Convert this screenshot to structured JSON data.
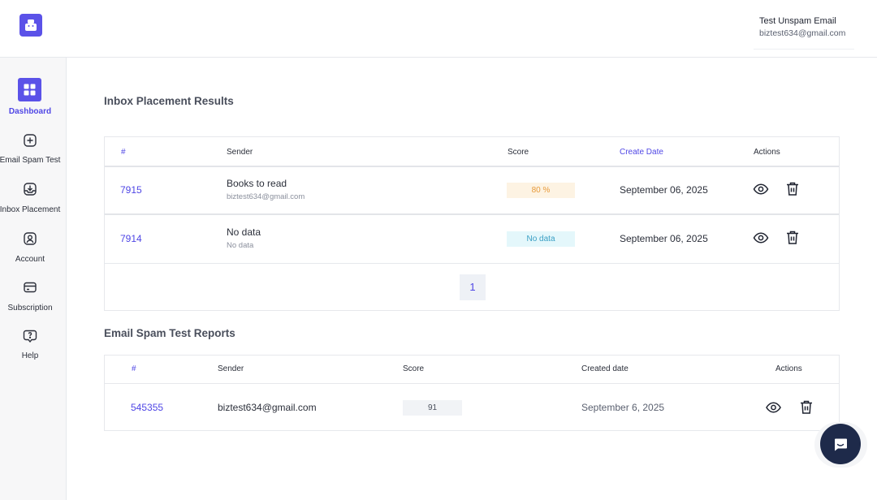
{
  "header": {
    "user_name": "Test Unspam Email",
    "user_email": "biztest634@gmail.com"
  },
  "sidebar": {
    "items": [
      {
        "label": "Dashboard",
        "icon": "grid-icon",
        "active": true
      },
      {
        "label": "Email Spam Test",
        "icon": "plus-square-icon"
      },
      {
        "label": "Inbox Placement",
        "icon": "inbox-download-icon"
      },
      {
        "label": "Account",
        "icon": "user-square-icon"
      },
      {
        "label": "Subscription",
        "icon": "card-icon"
      },
      {
        "label": "Help",
        "icon": "help-chat-icon"
      }
    ]
  },
  "inbox": {
    "title": "Inbox Placement Results",
    "columns": [
      "#",
      "Sender",
      "Score",
      "Create Date",
      "Actions"
    ],
    "rows": [
      {
        "id": "7915",
        "sender": "Books to read",
        "sender_email": "biztest634@gmail.com",
        "score": "80 %",
        "date": "September 06, 2025"
      },
      {
        "id": "7914",
        "sender": "No data",
        "sender_email": "No data",
        "score": "No data",
        "date": "September 06, 2025"
      }
    ],
    "page": "1"
  },
  "spam": {
    "title": "Email Spam Test Reports",
    "columns": [
      "#",
      "Sender",
      "Score",
      "Created date",
      "Actions"
    ],
    "rows": [
      {
        "id": "545355",
        "sender": "biztest634@gmail.com",
        "score": "91",
        "date": "September 6, 2025"
      }
    ]
  },
  "colors": {
    "accent": "#5b52e8",
    "link": "#4f46e5",
    "warn_badge": "#fdf3e3",
    "info_badge": "#e4f7fb",
    "chat": "#1e2a4a"
  }
}
